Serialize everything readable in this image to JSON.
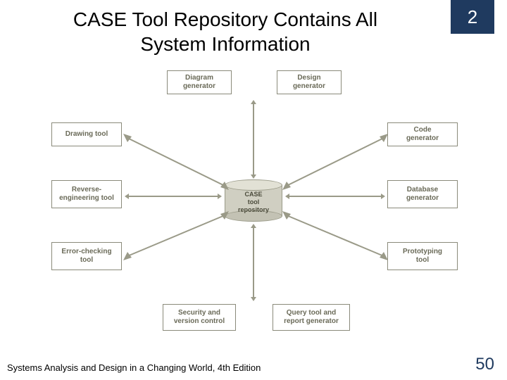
{
  "chapter": "2",
  "title": "CASE Tool Repository Contains All System Information",
  "center": {
    "label": "CASE\ntool\nrepository"
  },
  "nodes": {
    "diagram_generator": "Diagram\ngenerator",
    "design_generator": "Design\ngenerator",
    "drawing_tool": "Drawing tool",
    "code_generator": "Code\ngenerator",
    "reverse_engineering": "Reverse-\nengineering tool",
    "database_generator": "Database\ngenerator",
    "error_checking": "Error-checking\ntool",
    "prototyping": "Prototyping\ntool",
    "security_version": "Security and\nversion control",
    "query_report": "Query tool and\nreport generator"
  },
  "footer_left": "Systems Analysis and Design in a Changing World, 4th Edition",
  "page_number": "50"
}
